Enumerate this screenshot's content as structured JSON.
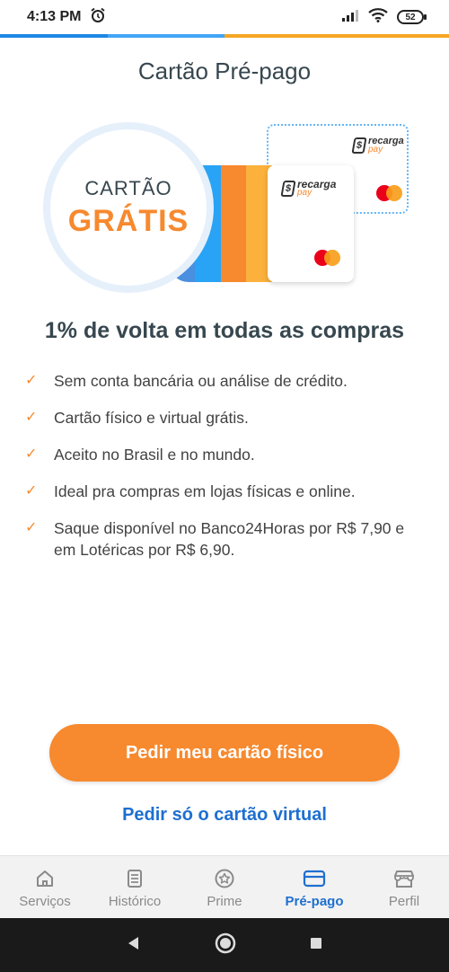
{
  "status_bar": {
    "time": "4:13 PM",
    "battery": "52",
    "icons": [
      "alarm-icon",
      "signal-icon",
      "wifi-icon",
      "battery-icon"
    ]
  },
  "colors": {
    "accent": "#f7892e",
    "link": "#1e6fd0",
    "text": "#37474f",
    "stripe_colors": [
      "#4a8fe0",
      "#29a3f5",
      "#f7892e",
      "#fbb13c"
    ]
  },
  "header": {
    "title": "Cartão Pré-pago"
  },
  "hero": {
    "line1": "CARTÃO",
    "line2": "GRÁTIS",
    "brand_top": "recarga",
    "brand_bottom": "pay",
    "brand_mark": "$",
    "card_network": "mastercard-logo"
  },
  "headline": "1% de volta em todas as compras",
  "benefits": [
    "Sem conta bancária ou análise de crédito.",
    "Cartão físico e virtual grátis.",
    "Aceito no Brasil e no mundo.",
    "Ideal pra compras em lojas físicas e online.",
    "Saque disponível no Banco24Horas por R$ 7,90 e em Lotéricas por R$ 6,90."
  ],
  "actions": {
    "primary": "Pedir meu cartão físico",
    "secondary": "Pedir só o cartão virtual"
  },
  "bottom_nav": {
    "active_index": 3,
    "items": [
      {
        "label": "Serviços",
        "icon": "home-icon"
      },
      {
        "label": "Histórico",
        "icon": "document-icon"
      },
      {
        "label": "Prime",
        "icon": "star-badge-icon"
      },
      {
        "label": "Pré-pago",
        "icon": "card-icon"
      },
      {
        "label": "Perfil",
        "icon": "store-icon"
      }
    ]
  },
  "system_nav": [
    "back-icon",
    "home-button-icon",
    "recents-icon"
  ]
}
